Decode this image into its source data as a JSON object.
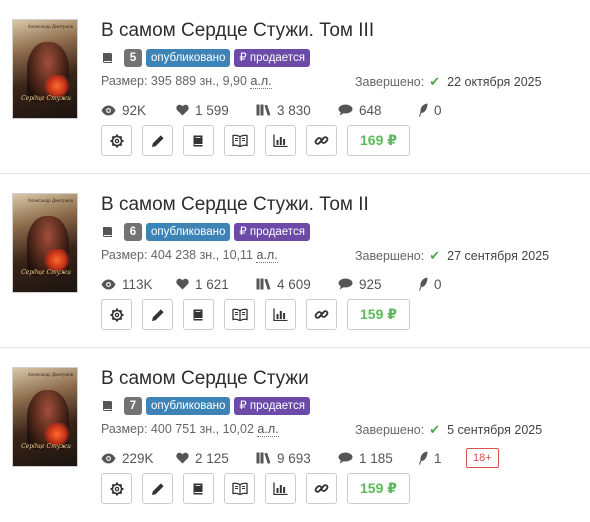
{
  "books": [
    {
      "cover_title": "Сердце Стужи",
      "cover_author": "Александр Дмитриев",
      "title": "В самом Сердце Стужи. Том III",
      "volume": "5",
      "status_badge": "опубликовано",
      "sale_badge": "продается",
      "size_label": "Размер:",
      "size_value": "395 889 зн., 9,90",
      "size_unit": "а.л.",
      "completed_label": "Завершено:",
      "completed_date": "22 октября 2025",
      "views": "92K",
      "likes": "1 599",
      "library": "3 830",
      "comments": "648",
      "awards": "0",
      "age": "",
      "price": "169 ₽"
    },
    {
      "cover_title": "Сердце Стужи",
      "cover_author": "Александр Дмитриев",
      "title": "В самом Сердце Стужи. Том II",
      "volume": "6",
      "status_badge": "опубликовано",
      "sale_badge": "продается",
      "size_label": "Размер:",
      "size_value": "404 238 зн., 10,11",
      "size_unit": "а.л.",
      "completed_label": "Завершено:",
      "completed_date": "27 сентября 2025",
      "views": "113K",
      "likes": "1 621",
      "library": "4 609",
      "comments": "925",
      "awards": "0",
      "age": "",
      "price": "159 ₽"
    },
    {
      "cover_title": "Сердце Стужи",
      "cover_author": "Александр Дмитриев",
      "title": "В самом Сердце Стужи",
      "volume": "7",
      "status_badge": "опубликовано",
      "sale_badge": "продается",
      "size_label": "Размер:",
      "size_value": "400 751 зн., 10,02",
      "size_unit": "а.л.",
      "completed_label": "Завершено:",
      "completed_date": "5 сентября 2025",
      "views": "229K",
      "likes": "2 125",
      "library": "9 693",
      "comments": "1 185",
      "awards": "1",
      "age": "18+",
      "price": "159 ₽"
    }
  ],
  "icons": {
    "book": "book-icon",
    "eye": "eye-icon",
    "heart": "heart-icon",
    "library": "library-icon",
    "comment": "comment-icon",
    "award": "feather-award-icon",
    "check": "check-icon",
    "tools": [
      "gear-icon",
      "pencil-icon",
      "book-icon",
      "open-book-icon",
      "bar-chart-icon",
      "link-icon"
    ]
  },
  "colors": {
    "published": "#3e83b5",
    "on_sale": "#6b4aa8",
    "count": "#737373",
    "price": "#5cb85c",
    "check": "#4fa84f",
    "age": "#d9534f"
  }
}
